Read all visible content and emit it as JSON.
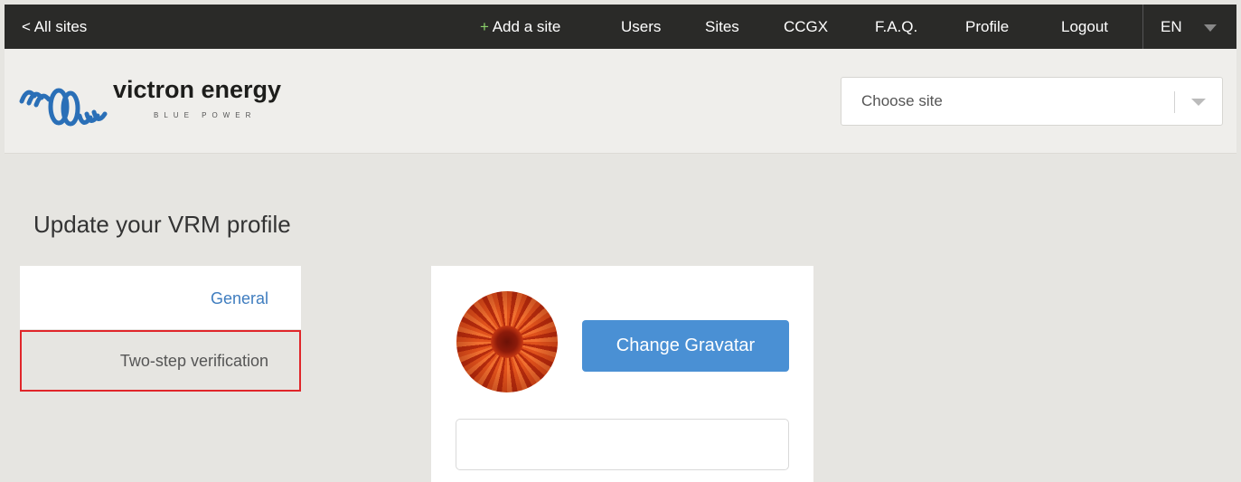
{
  "topnav": {
    "back_label": "< All sites",
    "add_site_label": "+ Add a site",
    "users_label": "Users",
    "sites_label": "Sites",
    "ccgx_label": "CCGX",
    "faq_label": "F.A.Q.",
    "profile_label": "Profile",
    "logout_label": "Logout",
    "language": "EN",
    "add_site_color": "#8bd16a"
  },
  "header": {
    "logo_text": "victron energy",
    "logo_tagline": "BLUE POWER",
    "site_select_placeholder": "Choose site"
  },
  "main": {
    "page_title": "Update your VRM profile",
    "side_nav": [
      {
        "label": "General",
        "active": true
      },
      {
        "label": "Two-step verification",
        "highlighted": true
      }
    ],
    "profile_card": {
      "change_gravatar_label": "Change Gravatar",
      "input_value": ""
    }
  },
  "colors": {
    "topbar_bg": "#2a2a28",
    "accent_blue": "#4a90d4",
    "link_blue": "#3f7dbf",
    "highlight_red": "#e0262a",
    "logo_blue": "#2a6fb7"
  }
}
